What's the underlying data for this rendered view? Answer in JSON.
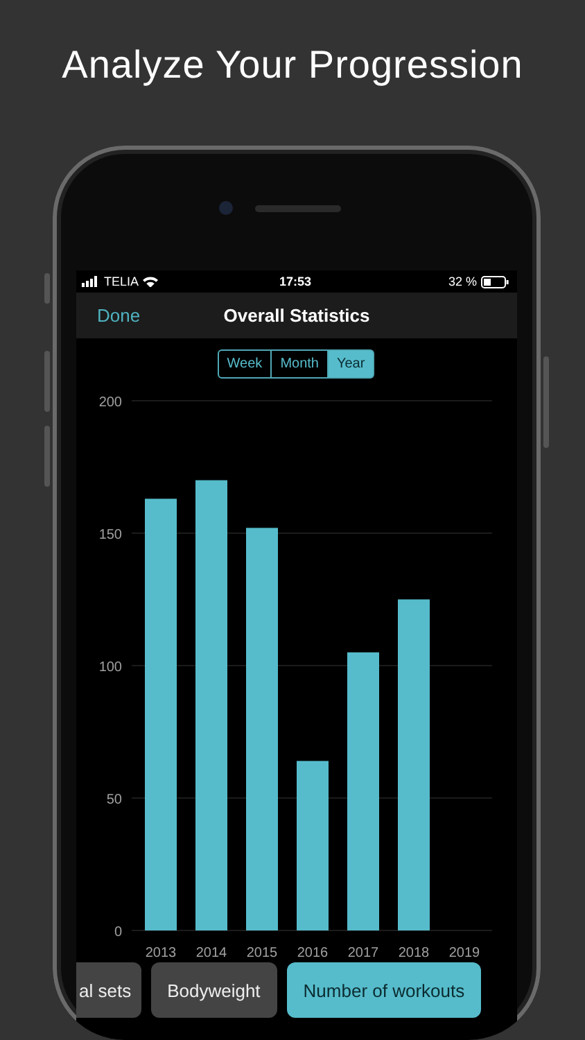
{
  "headline": "Analyze Your Progression",
  "status_bar": {
    "carrier": "TELIA",
    "time": "17:53",
    "battery": "32 %"
  },
  "nav": {
    "back": "Done",
    "title": "Overall Statistics"
  },
  "periods": [
    {
      "label": "Week",
      "selected": false
    },
    {
      "label": "Month",
      "selected": false
    },
    {
      "label": "Year",
      "selected": true
    }
  ],
  "chart_data": {
    "type": "bar",
    "categories": [
      "2013",
      "2014",
      "2015",
      "2016",
      "2017",
      "2018",
      "2019"
    ],
    "grid": true,
    "series": [
      {
        "color": "#56bccb",
        "values": [
          163,
          170,
          152,
          64,
          105,
          125,
          null
        ]
      }
    ],
    "ylim": [
      0,
      200
    ],
    "yticks": [
      0,
      50,
      100,
      150,
      200
    ]
  },
  "metrics": [
    {
      "label": "al sets",
      "selected": false
    },
    {
      "label": "Bodyweight",
      "selected": false
    },
    {
      "label": "Number of workouts",
      "selected": true
    }
  ]
}
